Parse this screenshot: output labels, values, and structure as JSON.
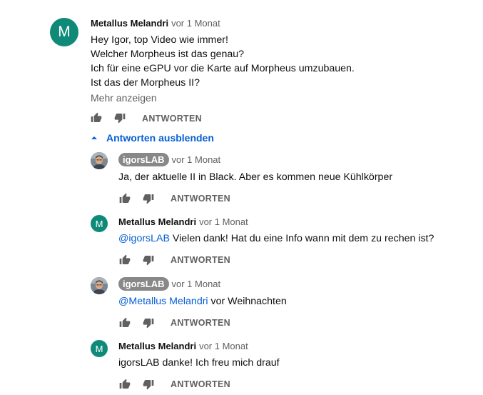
{
  "top_comment": {
    "avatar_letter": "M",
    "author": "Metallus Melandri",
    "time": "vor 1 Monat",
    "lines": [
      "Hey Igor, top Video wie immer!",
      "Welcher Morpheus ist das genau?",
      "Ich für eine eGPU vor die Karte auf Morpheus umzubauen.",
      "Ist das der Morpheus II?"
    ],
    "show_more": "Mehr anzeigen",
    "reply_label": "ANTWORTEN"
  },
  "hide_replies_label": "Antworten ausblenden",
  "replies": [
    {
      "author": "igorsLAB",
      "time": "vor 1 Monat",
      "mention": "",
      "text": "Ja, der aktuelle II in Black. Aber es kommen neue Kühlkörper",
      "reply_label": "ANTWORTEN"
    },
    {
      "avatar_letter": "M",
      "author": "Metallus Melandri",
      "time": "vor 1 Monat",
      "mention": "@igorsLAB",
      "text": " Vielen dank! Hat du eine Info wann mit dem zu rechen ist?",
      "reply_label": "ANTWORTEN"
    },
    {
      "author": "igorsLAB",
      "time": "vor 1 Monat",
      "mention": "@Metallus Melandri",
      "text": " vor Weihnachten",
      "reply_label": "ANTWORTEN"
    },
    {
      "avatar_letter": "M",
      "author": "Metallus Melandri",
      "time": "vor 1 Monat",
      "mention": "",
      "text": "igorsLAB danke! Ich freu mich drauf",
      "reply_label": "ANTWORTEN"
    }
  ],
  "colors": {
    "avatar_green": "#0f8a78",
    "link_blue": "#065fd4",
    "meta_gray": "#606060",
    "badge_gray": "#888888"
  }
}
